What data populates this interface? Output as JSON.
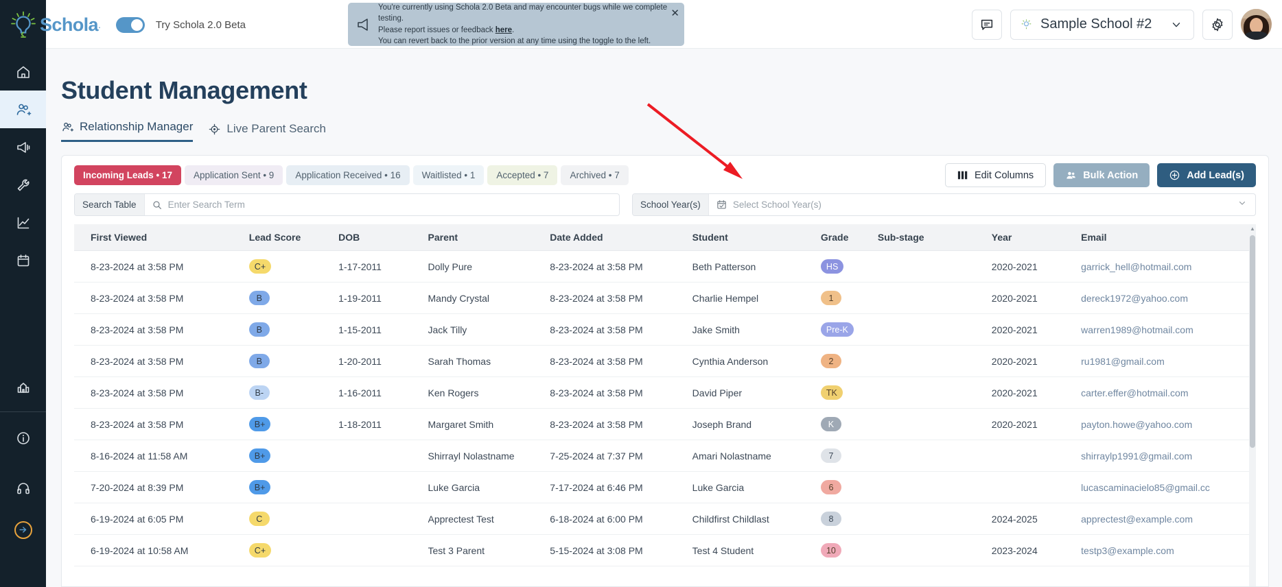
{
  "brand": {
    "name": "Schola",
    "beta_toggle_label": "Try Schola 2.0 Beta",
    "accent": "#5596c8"
  },
  "banner": {
    "line1": "You're currently using Schola 2.0 Beta and may encounter bugs while we complete testing.",
    "line2_before": "Please report issues or feedback ",
    "line2_link": "here",
    "line2_after": ".",
    "line3": "You can revert back to the prior version at any time using the toggle to the left.",
    "close_label": "✕",
    "background": "#b6c6d3"
  },
  "header": {
    "chat_icon": "chat-icon",
    "school_name": "Sample School #2",
    "gear_icon": "gear-icon",
    "avatar_icon": "user-avatar"
  },
  "sidebar": {
    "items": [
      {
        "name": "home",
        "label": "Home",
        "active": false
      },
      {
        "name": "students",
        "label": "Student Management",
        "active": true
      },
      {
        "name": "marketing",
        "label": "Marketing",
        "active": false
      },
      {
        "name": "tools",
        "label": "Tools",
        "active": false
      },
      {
        "name": "analytics",
        "label": "Analytics",
        "active": false
      },
      {
        "name": "calendar",
        "label": "Calendar",
        "active": false
      },
      {
        "name": "school",
        "label": "School Profile",
        "active": false
      },
      {
        "name": "info",
        "label": "Information",
        "active": false
      },
      {
        "name": "support",
        "label": "Support",
        "active": false
      },
      {
        "name": "expand",
        "label": "Expand Menu",
        "active": false
      }
    ]
  },
  "page": {
    "title": "Student Management",
    "tabs": [
      {
        "label": "Relationship Manager",
        "icon": "people-icon",
        "active": true
      },
      {
        "label": "Live Parent Search",
        "icon": "target-icon",
        "active": false
      }
    ]
  },
  "pills": [
    {
      "label": "Incoming Leads • 17",
      "active": true,
      "bg": "#d2445f"
    },
    {
      "label": "Application Sent • 9",
      "active": false,
      "bg": "#f0ecf4"
    },
    {
      "label": "Application Received • 16",
      "active": false,
      "bg": "#e7eef4"
    },
    {
      "label": "Waitlisted • 1",
      "active": false,
      "bg": "#eef4f8"
    },
    {
      "label": "Accepted • 7",
      "active": false,
      "bg": "#eff3e4"
    },
    {
      "label": "Archived • 7",
      "active": false,
      "bg": "#f1f2f4"
    }
  ],
  "toolbar": {
    "edit_columns": "Edit Columns",
    "bulk_action": "Bulk Action",
    "add_leads": "Add Lead(s)"
  },
  "filters": {
    "search_label": "Search Table",
    "search_placeholder": "Enter Search Term",
    "search_value": "",
    "year_label": "School Year(s)",
    "year_placeholder": "Select School Year(s)",
    "year_value": ""
  },
  "table": {
    "columns": [
      "First Viewed",
      "Lead Score",
      "DOB",
      "Parent",
      "Date Added",
      "Student",
      "Grade",
      "Sub-stage",
      "Year",
      "Email"
    ],
    "rows": [
      {
        "first_viewed": "8-23-2024 at 3:58 PM",
        "lead_score": "C+",
        "score_bg": "#f5d96b",
        "dob": "1-17-2011",
        "parent": "Dolly Pure",
        "date_added": "8-23-2024 at 3:58 PM",
        "student": "Beth Patterson",
        "grade": "HS",
        "grade_bg": "#8c93e0",
        "grade_fg": "#ffffff",
        "sub_stage": "",
        "year": "2020-2021",
        "email": "garrick_hell@hotmail.com"
      },
      {
        "first_viewed": "8-23-2024 at 3:58 PM",
        "lead_score": "B",
        "score_bg": "#7fa9e8",
        "dob": "1-19-2011",
        "parent": "Mandy Crystal",
        "date_added": "8-23-2024 at 3:58 PM",
        "student": "Charlie Hempel",
        "grade": "1",
        "grade_bg": "#f0c089",
        "grade_fg": "#55412c",
        "sub_stage": "",
        "year": "2020-2021",
        "email": "dereck1972@yahoo.com"
      },
      {
        "first_viewed": "8-23-2024 at 3:58 PM",
        "lead_score": "B",
        "score_bg": "#7fa9e8",
        "dob": "1-15-2011",
        "parent": "Jack Tilly",
        "date_added": "8-23-2024 at 3:58 PM",
        "student": "Jake Smith",
        "grade": "Pre-K",
        "grade_bg": "#9aa5e8",
        "grade_fg": "#ffffff",
        "sub_stage": "",
        "year": "2020-2021",
        "email": "warren1989@hotmail.com"
      },
      {
        "first_viewed": "8-23-2024 at 3:58 PM",
        "lead_score": "B",
        "score_bg": "#7fa9e8",
        "dob": "1-20-2011",
        "parent": "Sarah Thomas",
        "date_added": "8-23-2024 at 3:58 PM",
        "student": "Cynthia Anderson",
        "grade": "2",
        "grade_bg": "#efb383",
        "grade_fg": "#55412c",
        "sub_stage": "",
        "year": "2020-2021",
        "email": "ru1981@gmail.com"
      },
      {
        "first_viewed": "8-23-2024 at 3:58 PM",
        "lead_score": "B-",
        "score_bg": "#bcd4f3",
        "dob": "1-16-2011",
        "parent": "Ken Rogers",
        "date_added": "8-23-2024 at 3:58 PM",
        "student": "David Piper",
        "grade": "TK",
        "grade_bg": "#f0d070",
        "grade_fg": "#55412c",
        "sub_stage": "",
        "year": "2020-2021",
        "email": "carter.effer@hotmail.com"
      },
      {
        "first_viewed": "8-23-2024 at 3:58 PM",
        "lead_score": "B+",
        "score_bg": "#4f9ae8",
        "dob": "1-18-2011",
        "parent": "Margaret Smith",
        "date_added": "8-23-2024 at 3:58 PM",
        "student": "Joseph Brand",
        "grade": "K",
        "grade_bg": "#9fa9b5",
        "grade_fg": "#ffffff",
        "sub_stage": "",
        "year": "2020-2021",
        "email": "payton.howe@yahoo.com"
      },
      {
        "first_viewed": "8-16-2024 at 11:58 AM",
        "lead_score": "B+",
        "score_bg": "#4f9ae8",
        "dob": "",
        "parent": "Shirrayl Nolastname",
        "date_added": "7-25-2024 at 7:37 PM",
        "student": "Amari Nolastname",
        "grade": "7",
        "grade_bg": "#dfe3e8",
        "grade_fg": "#3c4856",
        "sub_stage": "",
        "year": "",
        "email": "shirraylp1991@gmail.com"
      },
      {
        "first_viewed": "7-20-2024 at 8:39 PM",
        "lead_score": "B+",
        "score_bg": "#4f9ae8",
        "dob": "",
        "parent": "Luke Garcia",
        "date_added": "7-17-2024 at 6:46 PM",
        "student": "Luke Garcia",
        "grade": "6",
        "grade_bg": "#f0a9a0",
        "grade_fg": "#55412c",
        "sub_stage": "",
        "year": "",
        "email": "lucascaminacielo85@gmail.cc"
      },
      {
        "first_viewed": "6-19-2024 at 6:05 PM",
        "lead_score": "C",
        "score_bg": "#f5d96b",
        "dob": "",
        "parent": "Apprectest Test",
        "date_added": "6-18-2024 at 6:00 PM",
        "student": "Childfirst Childlast",
        "grade": "8",
        "grade_bg": "#c9d1db",
        "grade_fg": "#3c4856",
        "sub_stage": "",
        "year": "2024-2025",
        "email": "apprectest@example.com"
      },
      {
        "first_viewed": "6-19-2024 at 10:58 AM",
        "lead_score": "C+",
        "score_bg": "#f5d96b",
        "dob": "",
        "parent": "Test 3 Parent",
        "date_added": "5-15-2024 at 3:08 PM",
        "student": "Test 4 Student",
        "grade": "10",
        "grade_bg": "#f0a9b8",
        "grade_fg": "#55412c",
        "sub_stage": "",
        "year": "2023-2024",
        "email": "testp3@example.com"
      }
    ]
  }
}
